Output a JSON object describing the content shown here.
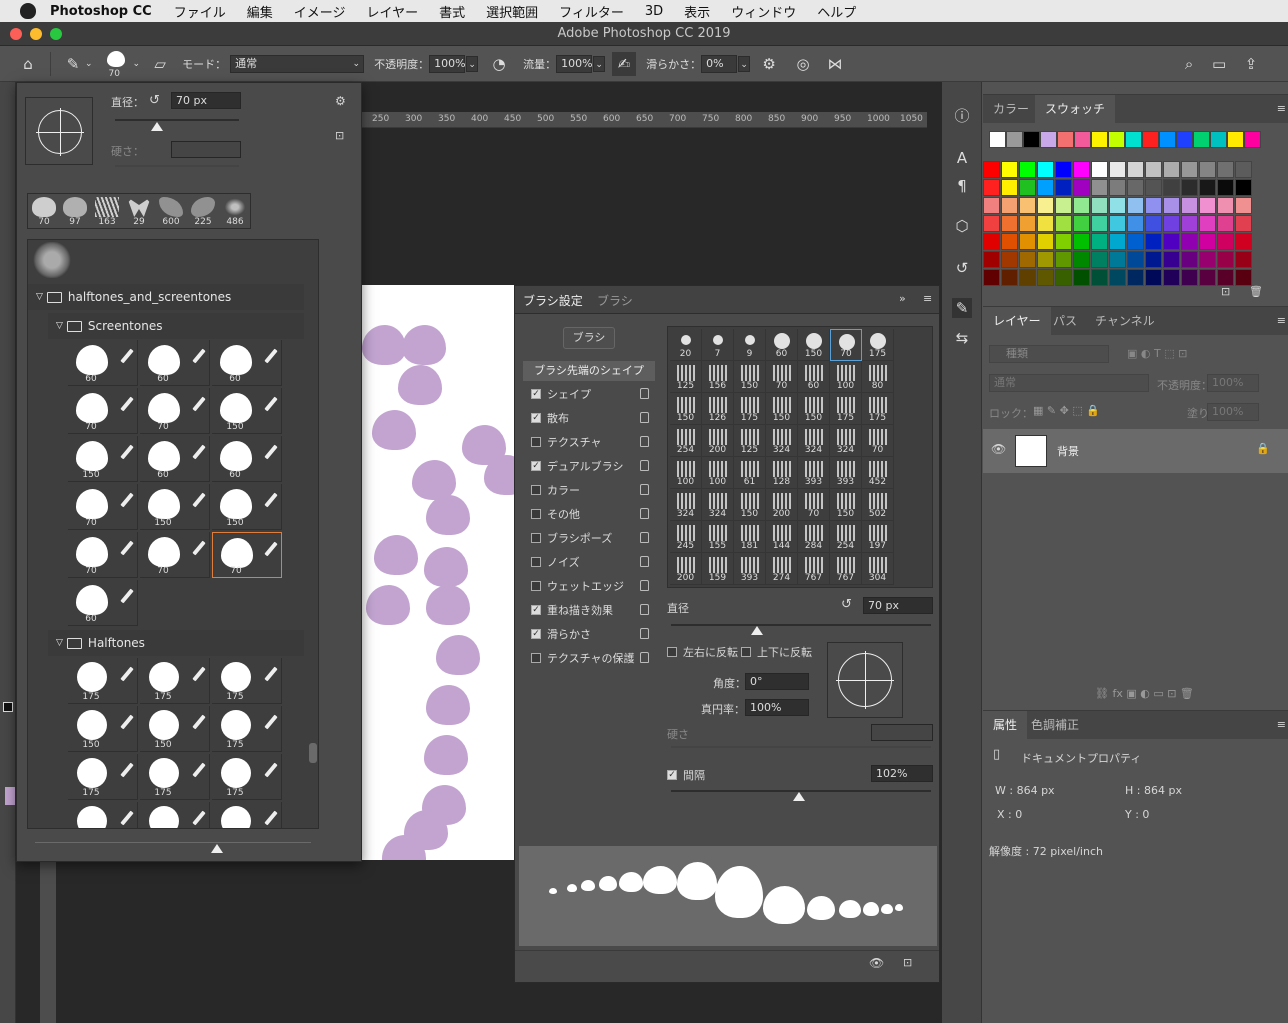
{
  "menubar": {
    "app": "Photoshop CC",
    "items": [
      "ファイル",
      "編集",
      "イメージ",
      "レイヤー",
      "書式",
      "選択範囲",
      "フィルター",
      "3D",
      "表示",
      "ウィンドウ",
      "ヘルプ"
    ]
  },
  "window": {
    "title": "Adobe Photoshop CC 2019"
  },
  "options": {
    "brush_size": "70",
    "mode_label": "モード：",
    "mode_value": "通常",
    "opacity_label": "不透明度：",
    "opacity_value": "100%",
    "flow_label": "流量：",
    "flow_value": "100%",
    "smooth_label": "滑らかさ：",
    "smooth_value": "0%"
  },
  "picker": {
    "diameter_label": "直径：",
    "diameter_value": "70 px",
    "hardness_label": "硬さ：",
    "recent": [
      "70",
      "97",
      "163",
      "29",
      "600",
      "225",
      "486"
    ],
    "group": "halftones_and_screentones",
    "sub1": "Screentones",
    "sub2": "Halftones",
    "screentones": [
      "60",
      "60",
      "60",
      "70",
      "70",
      "150",
      "150",
      "60",
      "60",
      "70",
      "150",
      "150",
      "70",
      "70",
      "70",
      "60"
    ],
    "halftones": [
      "175",
      "175",
      "175",
      "150",
      "150",
      "175",
      "175",
      "175",
      "175"
    ]
  },
  "ruler": {
    "ticks": [
      "250",
      "300",
      "350",
      "400",
      "450",
      "500",
      "550",
      "600",
      "650",
      "700",
      "750",
      "800",
      "850",
      "900",
      "950",
      "1000",
      "1050"
    ]
  },
  "settings": {
    "tab1": "ブラシ設定",
    "tab2": "ブラシ",
    "brush_button": "ブラシ",
    "section": "ブラシ先端のシェイプ",
    "categories": [
      {
        "label": "シェイプ",
        "on": true
      },
      {
        "label": "散布",
        "on": true
      },
      {
        "label": "テクスチャ",
        "on": false
      },
      {
        "label": "デュアルブラシ",
        "on": true
      },
      {
        "label": "カラー",
        "on": false
      },
      {
        "label": "その他",
        "on": false
      },
      {
        "label": "ブラシポーズ",
        "on": false
      },
      {
        "label": "ノイズ",
        "on": false
      },
      {
        "label": "ウェットエッジ",
        "on": false
      },
      {
        "label": "重ね描き効果",
        "on": true
      },
      {
        "label": "滑らかさ",
        "on": true
      },
      {
        "label": "テクスチャの保護",
        "on": false
      }
    ],
    "tips": [
      "20",
      "7",
      "9",
      "60",
      "150",
      "70",
      "175",
      "125",
      "156",
      "150",
      "70",
      "60",
      "100",
      "80",
      "150",
      "126",
      "175",
      "150",
      "150",
      "175",
      "175",
      "254",
      "200",
      "125",
      "324",
      "324",
      "324",
      "70",
      "100",
      "100",
      "61",
      "128",
      "393",
      "393",
      "452",
      "324",
      "324",
      "150",
      "200",
      "70",
      "150",
      "502",
      "245",
      "155",
      "181",
      "144",
      "284",
      "254",
      "197",
      "200",
      "159",
      "393",
      "274",
      "767",
      "767",
      "304"
    ],
    "diameter_label": "直径",
    "diameter_value": "70 px",
    "flipx": "左右に反転",
    "flipy": "上下に反転",
    "angle_label": "角度：",
    "angle_value": "0°",
    "round_label": "真円率：",
    "round_value": "100%",
    "hardness_label": "硬さ",
    "spacing_label": "間隔",
    "spacing_value": "102%"
  },
  "swatches": {
    "tab1": "カラー",
    "tab2": "スウォッチ"
  },
  "layers": {
    "tabs": [
      "レイヤー",
      "パス",
      "チャンネル"
    ],
    "filter": "種類",
    "blend": "通常",
    "opacity_label": "不透明度：",
    "opacity_value": "100%",
    "lock_label": "ロック：",
    "fill_label": "塗り：",
    "fill_value": "100%",
    "layer_name": "背景"
  },
  "props": {
    "tabs": [
      "属性",
      "色調補正"
    ],
    "title": "ドキュメントプロパティ",
    "w": "W : 864 px",
    "h": "H : 864 px",
    "x": "X : 0",
    "y": "Y : 0",
    "res": "解像度 : 72 pixel/inch"
  },
  "colors": {
    "accent_orange": "#e07d3a",
    "brush_lilac": "#c3a4d1"
  }
}
